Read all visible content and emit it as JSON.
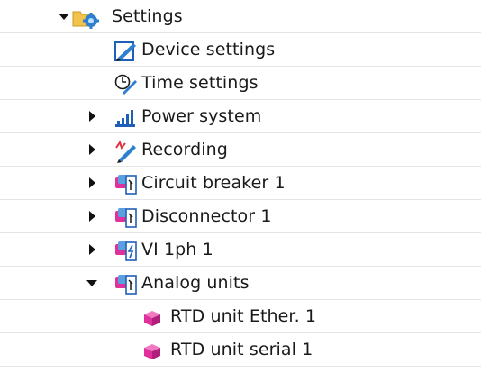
{
  "tree": {
    "settings": {
      "label": "Settings",
      "icon": "folder-settings-icon",
      "expanded": true
    },
    "device_settings": {
      "label": "Device settings",
      "icon": "device-settings-icon"
    },
    "time_settings": {
      "label": "Time settings",
      "icon": "time-settings-icon"
    },
    "power_system": {
      "label": "Power system",
      "icon": "power-system-icon",
      "expanded": false
    },
    "recording": {
      "label": "Recording",
      "icon": "recording-icon",
      "expanded": false
    },
    "circuit_breaker": {
      "label": "Circuit breaker 1",
      "icon": "function-group-icon",
      "expanded": false
    },
    "disconnector": {
      "label": "Disconnector 1",
      "icon": "function-group-icon",
      "expanded": false
    },
    "vi_1ph": {
      "label": "VI 1ph 1",
      "icon": "function-group-vi-icon",
      "expanded": false
    },
    "analog_units": {
      "label": "Analog units",
      "icon": "function-group-icon",
      "expanded": true
    },
    "rtd_ether": {
      "label": "RTD unit Ether. 1",
      "icon": "rtd-unit-icon"
    },
    "rtd_serial": {
      "label": "RTD unit serial 1",
      "icon": "rtd-unit-icon"
    }
  },
  "colors": {
    "row_divider": "#e4e4e4",
    "folder": "#f3c24b",
    "gear": "#2f7fd1",
    "fg_magenta": "#e0309c",
    "fg_blue": "#1f5fb8"
  }
}
